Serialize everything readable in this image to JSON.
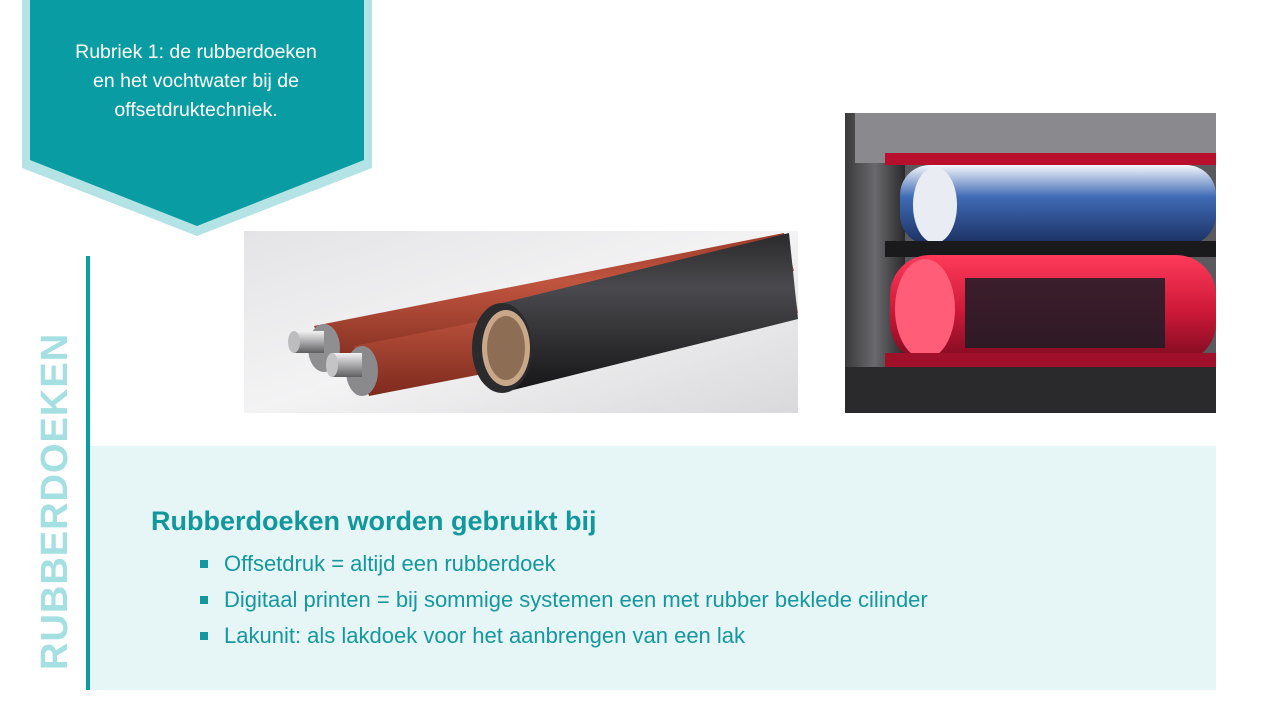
{
  "banner": {
    "text": "Rubriek 1: de rubberdoeken en het vochtwater bij de offsetdruktechniek."
  },
  "section": {
    "vertical_title": "RUBBERDOEKEN"
  },
  "content": {
    "heading": "Rubberdoeken worden gebruikt bij",
    "bullets": [
      "Offsetdruk = altijd een rubberdoek",
      "Digitaal printen = bij sommige systemen een met rubber beklede cilinder",
      "Lakunit: als lakdoek voor het aanbrengen van een lak"
    ]
  },
  "colors": {
    "accent": "#0a9ca3",
    "accent_light": "#a4dfe1",
    "panel": "#e6f5f6"
  }
}
